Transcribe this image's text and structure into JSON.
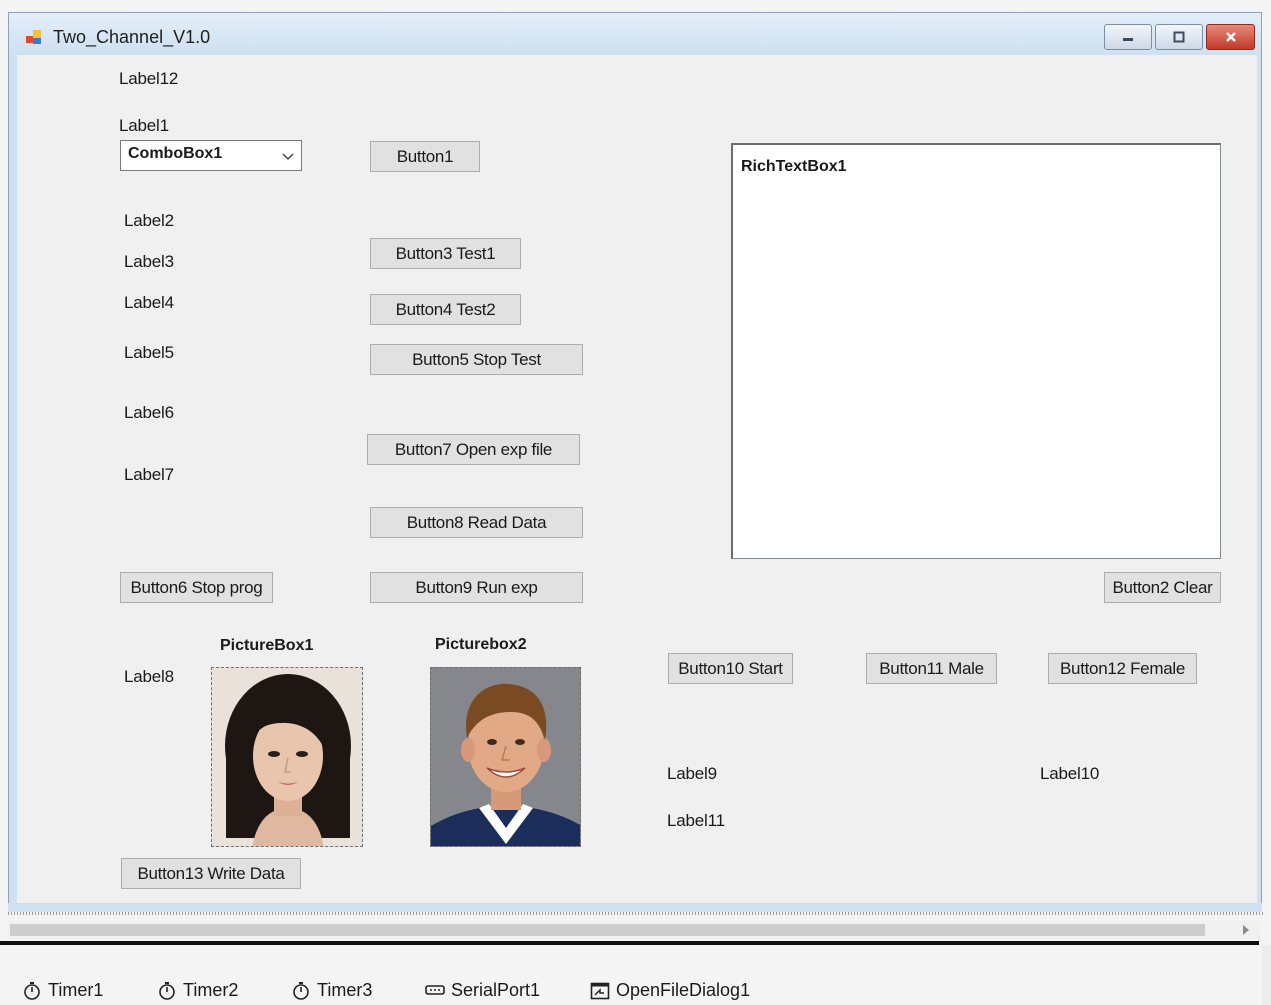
{
  "window": {
    "title": "Two_Channel_V1.0",
    "colors": {
      "title_bar": "#cfe0f1",
      "client": "#f0f0f0",
      "close": "#c4392a"
    }
  },
  "labels": {
    "label12": "Label12",
    "label1": "Label1",
    "label2": "Label2",
    "label3": "Label3",
    "label4": "Label4",
    "label5": "Label5",
    "label6": "Label6",
    "label7": "Label7",
    "label8": "Label8",
    "label9": "Label9",
    "label10": "Label10",
    "label11": "Label11"
  },
  "combobox": {
    "value": "ComboBox1"
  },
  "buttons": {
    "button1": "Button1",
    "button3": "Button3 Test1",
    "button4": "Button4 Test2",
    "button5": "Button5 Stop Test",
    "button7": "Button7 Open exp file",
    "button8": "Button8 Read Data",
    "button6": "Button6 Stop prog",
    "button9": "Button9 Run exp",
    "button2": "Button2 Clear",
    "button10": "Button10 Start",
    "button11": "Button11 Male",
    "button12": "Button12 Female",
    "button13": "Button13 Write Data"
  },
  "richtextbox": {
    "text": "RichTextBox1"
  },
  "pictureboxes": {
    "pic1_label": "PictureBox1",
    "pic2_label": "Picturebox2"
  },
  "component_tray": {
    "items": [
      {
        "label": "Timer1",
        "icon": "stopwatch-icon"
      },
      {
        "label": "Timer2",
        "icon": "stopwatch-icon"
      },
      {
        "label": "Timer3",
        "icon": "stopwatch-icon"
      },
      {
        "label": "SerialPort1",
        "icon": "serial-port-icon"
      },
      {
        "label": "OpenFileDialog1",
        "icon": "open-file-dialog-icon"
      }
    ]
  }
}
